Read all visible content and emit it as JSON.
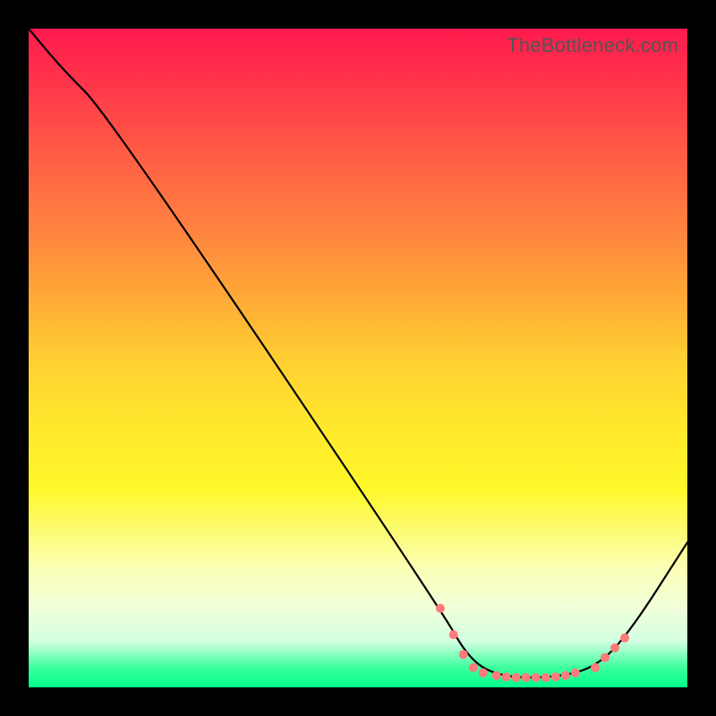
{
  "watermark": "TheBottleneck.com",
  "chart_data": {
    "type": "line",
    "title": "",
    "xlabel": "",
    "ylabel": "",
    "xlim": [
      0,
      100
    ],
    "ylim": [
      0,
      100
    ],
    "series": [
      {
        "name": "bottleneck-curve",
        "points": [
          {
            "x": 0,
            "y": 100
          },
          {
            "x": 5,
            "y": 94
          },
          {
            "x": 12,
            "y": 87
          },
          {
            "x": 62.5,
            "y": 12
          },
          {
            "x": 67,
            "y": 4
          },
          {
            "x": 72,
            "y": 1.5
          },
          {
            "x": 80,
            "y": 1.5
          },
          {
            "x": 86,
            "y": 3
          },
          {
            "x": 91,
            "y": 8
          },
          {
            "x": 100,
            "y": 22
          }
        ]
      }
    ],
    "markers": [
      {
        "x": 62.5,
        "y": 12
      },
      {
        "x": 64.5,
        "y": 8
      },
      {
        "x": 66,
        "y": 5
      },
      {
        "x": 67.5,
        "y": 3
      },
      {
        "x": 69,
        "y": 2.2
      },
      {
        "x": 71,
        "y": 1.8
      },
      {
        "x": 72.5,
        "y": 1.6
      },
      {
        "x": 74,
        "y": 1.5
      },
      {
        "x": 75.5,
        "y": 1.5
      },
      {
        "x": 77,
        "y": 1.5
      },
      {
        "x": 78.5,
        "y": 1.5
      },
      {
        "x": 80,
        "y": 1.6
      },
      {
        "x": 81.5,
        "y": 1.8
      },
      {
        "x": 83,
        "y": 2.2
      },
      {
        "x": 86,
        "y": 3
      },
      {
        "x": 87.5,
        "y": 4.5
      },
      {
        "x": 89,
        "y": 6
      },
      {
        "x": 90.5,
        "y": 7.5
      }
    ],
    "background_gradient": {
      "orientation": "vertical",
      "stops": [
        {
          "pos": 0.0,
          "color": "#ff1a4d"
        },
        {
          "pos": 0.5,
          "color": "#ffce32"
        },
        {
          "pos": 0.8,
          "color": "#fbffb6"
        },
        {
          "pos": 1.0,
          "color": "#00ff8b"
        }
      ]
    }
  }
}
